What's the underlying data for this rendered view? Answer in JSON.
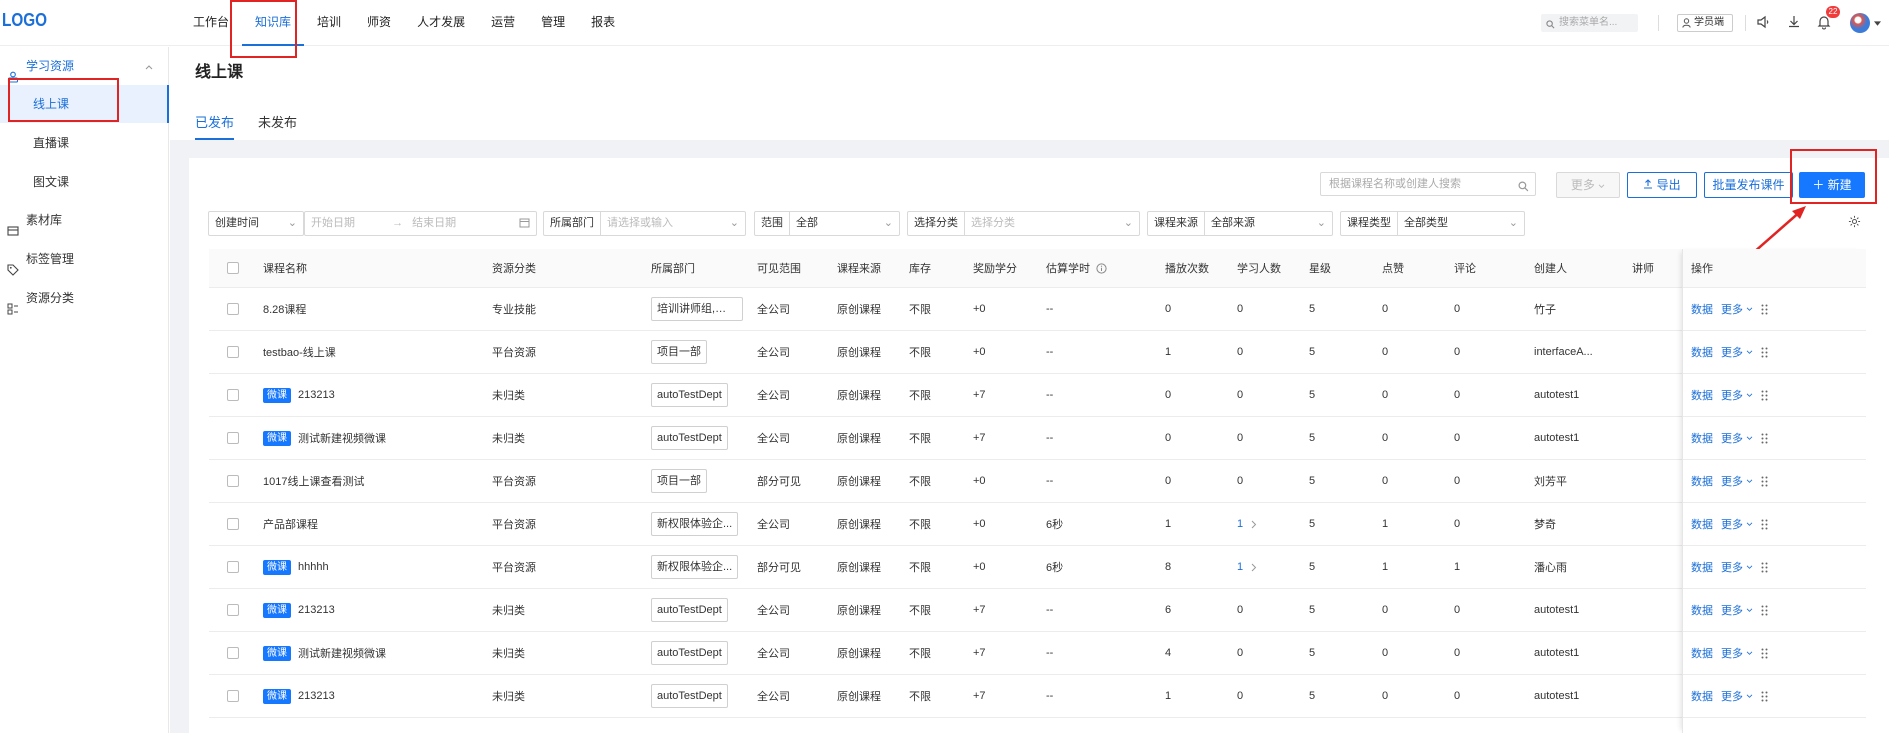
{
  "header": {
    "logo": "LOGO",
    "nav": [
      "工作台",
      "知识库",
      "培训",
      "师资",
      "人才发展",
      "运营",
      "管理",
      "报表"
    ],
    "active_nav": "知识库",
    "search_placeholder": "搜索菜单名...",
    "student_button": "学员端",
    "notification_count": "22"
  },
  "sidebar": {
    "group_learning": "学习资源",
    "items": [
      "线上课",
      "直播课",
      "图文课"
    ],
    "group_material": "素材库",
    "group_tags": "标签管理",
    "group_category": "资源分类"
  },
  "page": {
    "title": "线上课",
    "tabs": [
      "已发布",
      "未发布"
    ]
  },
  "toolbar": {
    "search_placeholder": "根据课程名称或创建人搜索",
    "more": "更多",
    "export": "导出",
    "batch_publish": "批量发布课件",
    "new": "新建"
  },
  "filters": {
    "created_time_label": "创建时间",
    "start_date": "开始日期",
    "end_date": "结束日期",
    "dept_label": "所属部门",
    "dept_placeholder": "请选择或输入",
    "scope_label": "范围",
    "scope_value": "全部",
    "category_label": "选择分类",
    "category_placeholder": "选择分类",
    "source_label": "课程来源",
    "source_value": "全部来源",
    "type_label": "课程类型",
    "type_value": "全部类型"
  },
  "table": {
    "columns": [
      "课程名称",
      "资源分类",
      "所属部门",
      "可见范围",
      "课程来源",
      "库存",
      "奖励学分",
      "估算学时",
      "播放次数",
      "学习人数",
      "星级",
      "点赞",
      "评论",
      "创建人",
      "讲师",
      "操作"
    ],
    "action_data": "数据",
    "action_more": "更多",
    "rows": [
      {
        "tag": "",
        "name": "8.28课程",
        "category": "专业技能",
        "dept": "培训讲师组,培训...",
        "scope": "全公司",
        "source": "原创课程",
        "stock": "不限",
        "credit": "+0",
        "hours": "--",
        "plays": "0",
        "learners": "0",
        "stars": "5",
        "likes": "0",
        "comments": "0",
        "creator": "竹子"
      },
      {
        "tag": "",
        "name": "testbao-线上课",
        "category": "平台资源",
        "dept": "项目一部",
        "scope": "全公司",
        "source": "原创课程",
        "stock": "不限",
        "credit": "+0",
        "hours": "--",
        "plays": "1",
        "learners": "0",
        "stars": "5",
        "likes": "0",
        "comments": "0",
        "creator": "interfaceA..."
      },
      {
        "tag": "微课",
        "name": "213213",
        "category": "未归类",
        "dept": "autoTestDept",
        "scope": "全公司",
        "source": "原创课程",
        "stock": "不限",
        "credit": "+7",
        "hours": "--",
        "plays": "0",
        "learners": "0",
        "stars": "5",
        "likes": "0",
        "comments": "0",
        "creator": "autotest1"
      },
      {
        "tag": "微课",
        "name": "测试新建视频微课",
        "category": "未归类",
        "dept": "autoTestDept",
        "scope": "全公司",
        "source": "原创课程",
        "stock": "不限",
        "credit": "+7",
        "hours": "--",
        "plays": "0",
        "learners": "0",
        "stars": "5",
        "likes": "0",
        "comments": "0",
        "creator": "autotest1"
      },
      {
        "tag": "",
        "name": "1017线上课查看测试",
        "category": "平台资源",
        "dept": "项目一部",
        "scope": "部分可见",
        "source": "原创课程",
        "stock": "不限",
        "credit": "+0",
        "hours": "--",
        "plays": "0",
        "learners": "0",
        "stars": "5",
        "likes": "0",
        "comments": "0",
        "creator": "刘芳平"
      },
      {
        "tag": "",
        "name": "产品部课程",
        "category": "平台资源",
        "dept": "新权限体验企...",
        "scope": "全公司",
        "source": "原创课程",
        "stock": "不限",
        "credit": "+0",
        "hours": "6秒",
        "plays": "1",
        "learners": "1",
        "stars": "5",
        "likes": "1",
        "comments": "0",
        "creator": "梦奇"
      },
      {
        "tag": "微课",
        "name": "hhhhh",
        "category": "平台资源",
        "dept": "新权限体验企...",
        "scope": "部分可见",
        "source": "原创课程",
        "stock": "不限",
        "credit": "+0",
        "hours": "6秒",
        "plays": "8",
        "learners": "1",
        "stars": "5",
        "likes": "1",
        "comments": "1",
        "creator": "潘心雨"
      },
      {
        "tag": "微课",
        "name": "213213",
        "category": "未归类",
        "dept": "autoTestDept",
        "scope": "全公司",
        "source": "原创课程",
        "stock": "不限",
        "credit": "+7",
        "hours": "--",
        "plays": "6",
        "learners": "0",
        "stars": "5",
        "likes": "0",
        "comments": "0",
        "creator": "autotest1"
      },
      {
        "tag": "微课",
        "name": "测试新建视频微课",
        "category": "未归类",
        "dept": "autoTestDept",
        "scope": "全公司",
        "source": "原创课程",
        "stock": "不限",
        "credit": "+7",
        "hours": "--",
        "plays": "4",
        "learners": "0",
        "stars": "5",
        "likes": "0",
        "comments": "0",
        "creator": "autotest1"
      },
      {
        "tag": "微课",
        "name": "213213",
        "category": "未归类",
        "dept": "autoTestDept",
        "scope": "全公司",
        "source": "原创课程",
        "stock": "不限",
        "credit": "+7",
        "hours": "--",
        "plays": "1",
        "learners": "0",
        "stars": "5",
        "likes": "0",
        "comments": "0",
        "creator": "autotest1"
      }
    ]
  },
  "colors": {
    "accent": "#1a6fd9",
    "primary_button": "#1677ff",
    "annotation_red": "#e02424"
  }
}
